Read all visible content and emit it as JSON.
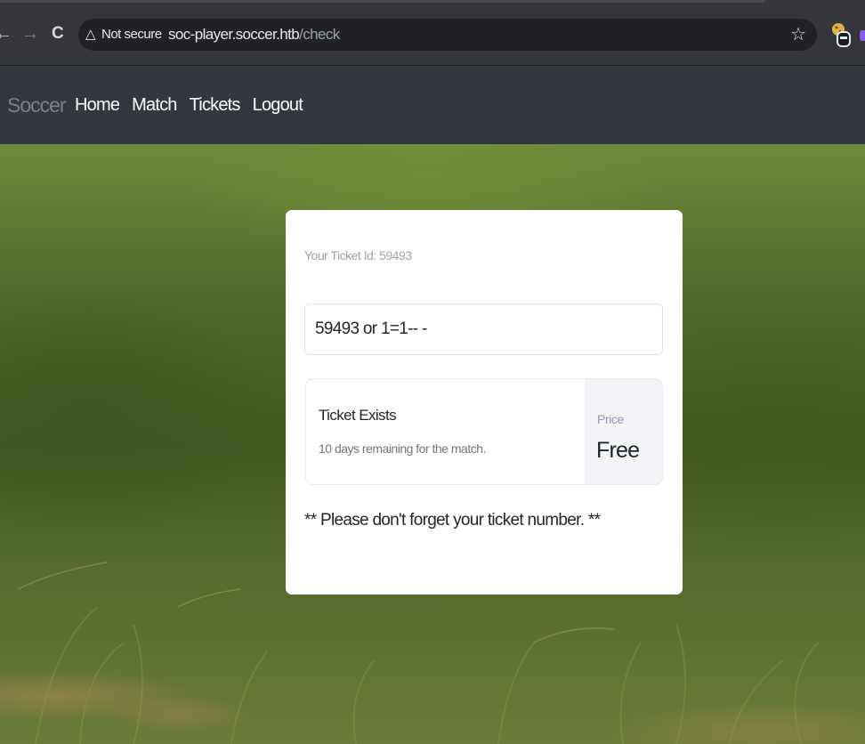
{
  "browser": {
    "security_label": "Not secure",
    "url_host": "soc-player.soccer.htb",
    "url_path": "/check",
    "icons": {
      "back": "arrow-left-icon",
      "forward": "arrow-right-icon",
      "reload": "reload-icon",
      "warning": "warning-triangle-icon",
      "bookmark": "star-icon",
      "extension": "cookie-extension-icon"
    }
  },
  "site": {
    "brand": "Soccer",
    "nav": [
      "Home",
      "Match",
      "Tickets",
      "Logout"
    ]
  },
  "card": {
    "ticket_id_label": "Your Ticket Id: 59493",
    "input_value": "59493 or 1=1-- -",
    "result_title": "Ticket Exists",
    "result_subtitle": "10 days remaining for the match.",
    "price_label": "Price",
    "price_value": "Free",
    "reminder": "** Please don't forget your ticket number. **"
  }
}
